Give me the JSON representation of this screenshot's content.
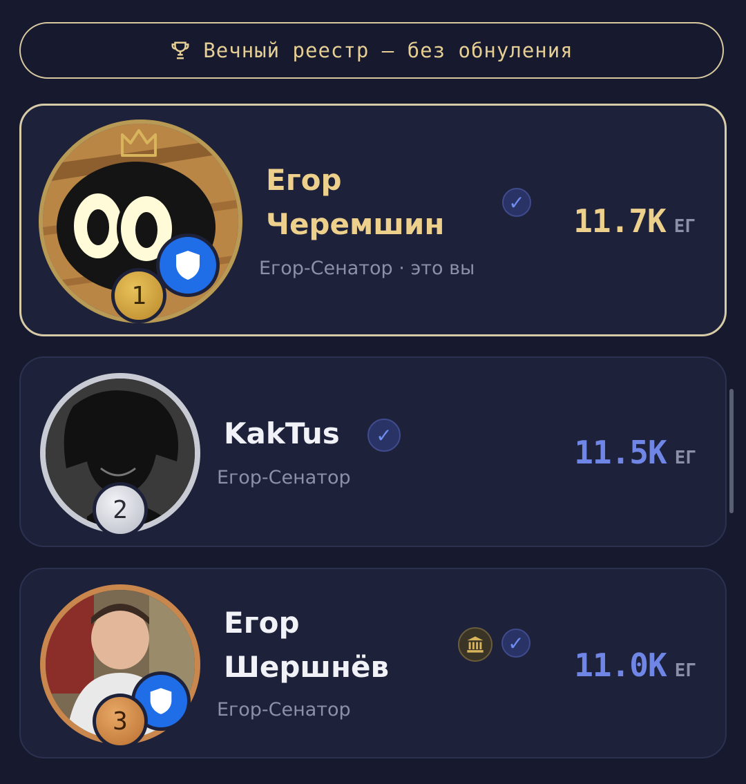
{
  "banner": {
    "icon": "trophy-icon",
    "text": "Вечный реестр — без обнуления"
  },
  "entries": [
    {
      "rank": "1",
      "name_line1": "Егор",
      "name_line2": "Черемшин",
      "role": "Егор-Сенатор · это вы",
      "score": "11.7K",
      "unit": "ЕГ",
      "name_color": "#ecd08c",
      "score_color": "#ecd08c"
    },
    {
      "rank": "2",
      "name_line1": "KakTus",
      "role": "Егор-Сенатор",
      "score": "11.5K",
      "unit": "ЕГ",
      "name_color": "#f1f2f7",
      "score_color": "#6f86e6"
    },
    {
      "rank": "3",
      "name_line1": "Егор",
      "name_line2": "Шершнёв",
      "role": "Егор-Сенатор",
      "score": "11.0K",
      "unit": "ЕГ",
      "name_color": "#f1f2f7",
      "score_color": "#6f86e6"
    }
  ],
  "colors": {
    "gold": "#d5a83a",
    "silver": "#d7d9e3",
    "bronze": "#d48d4a",
    "accent_blue": "#6f86e6"
  }
}
